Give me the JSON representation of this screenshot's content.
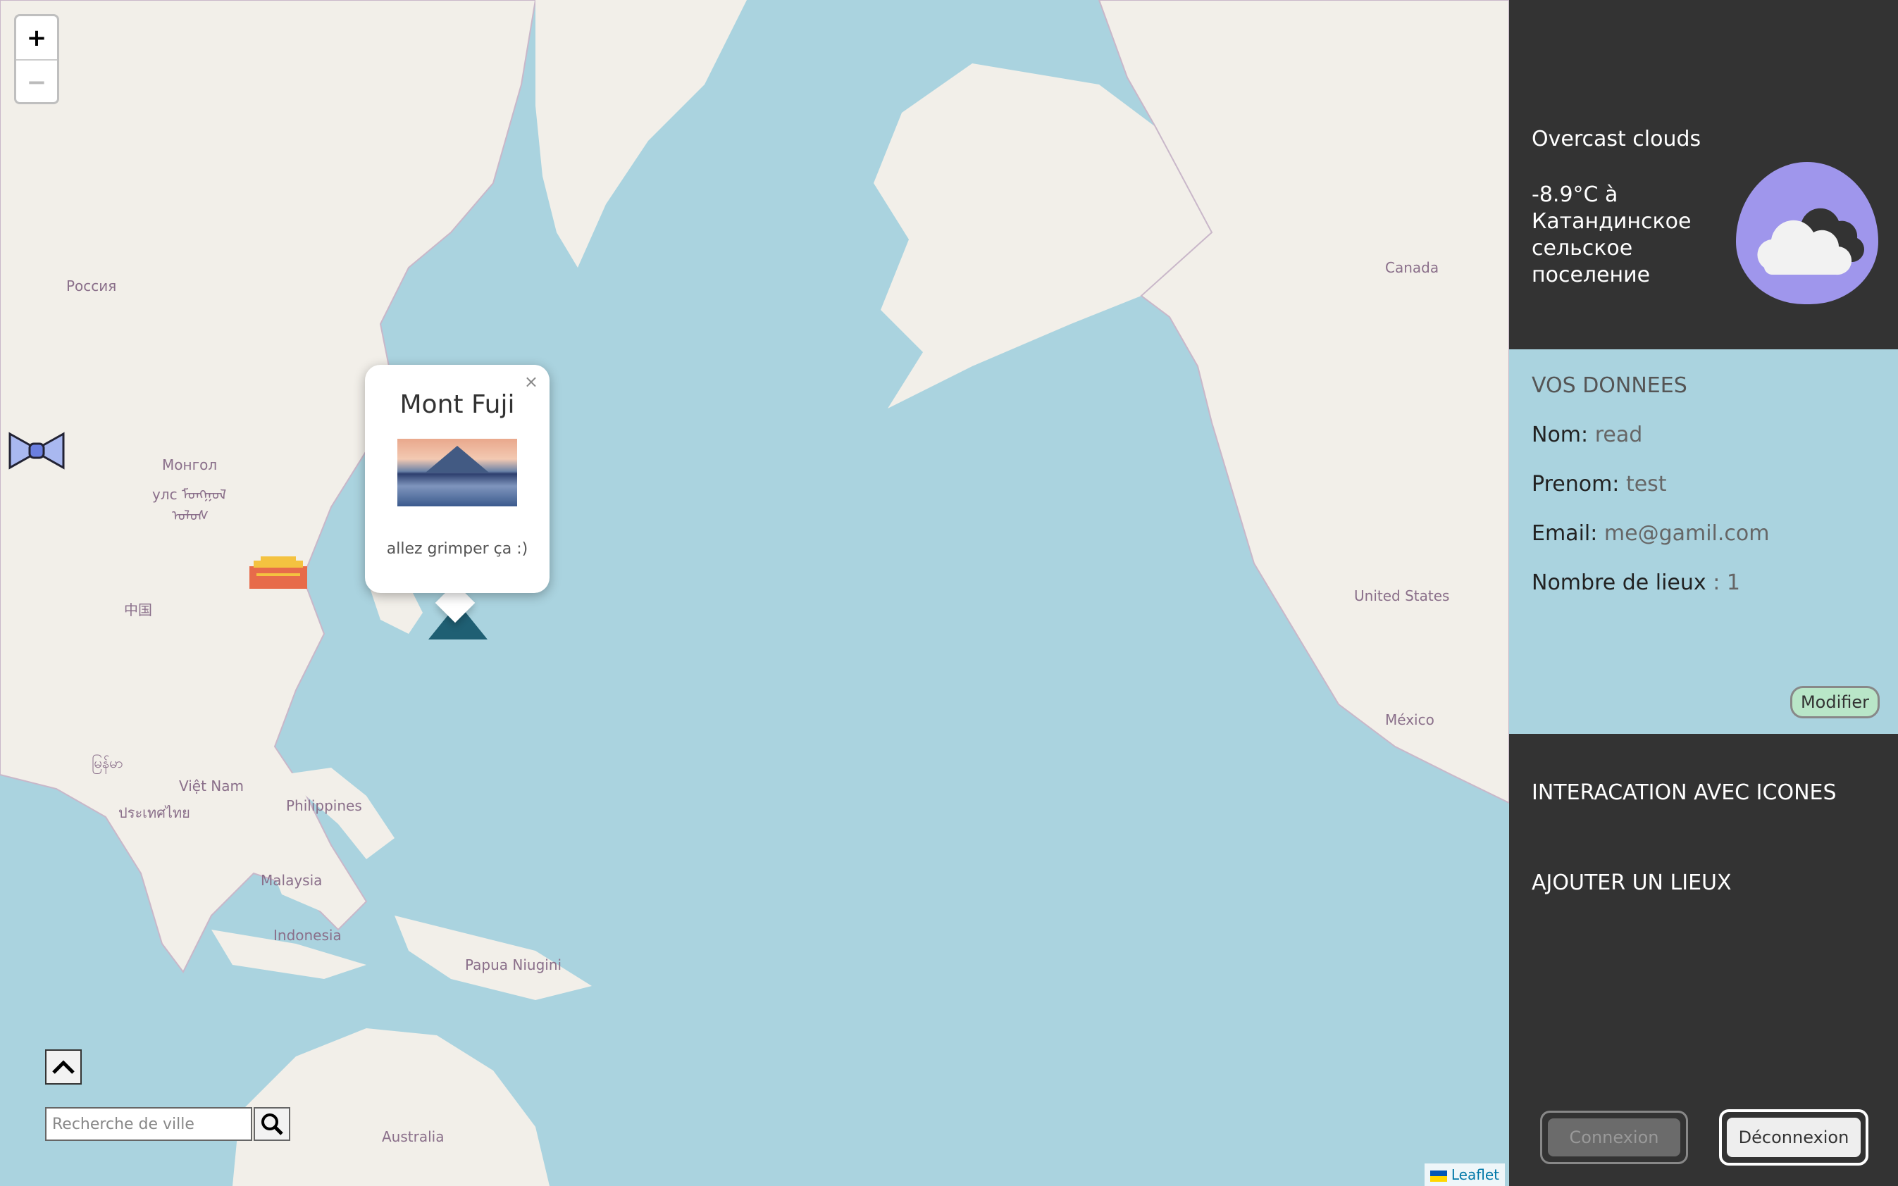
{
  "map": {
    "zoom_in": "+",
    "zoom_out": "−",
    "labels": {
      "russia": "Россия",
      "mongolia_1": "Монгол",
      "mongolia_2": "улс ᠮᠤᠩᠭᠤᠯ",
      "mongolia_3": "ᠤᠯᠤᠰ",
      "china": "中国",
      "myanmar": "မြန်မာ",
      "vietnam": "Việt Nam",
      "thailand": "ประเทศไทย",
      "philippines": "Philippines",
      "malaysia": "Malaysia",
      "indonesia": "Indonesia",
      "png": "Papua Niugini",
      "australia": "Australia",
      "canada": "Canada",
      "usa": "United States",
      "mexico": "México"
    },
    "popup": {
      "close": "×",
      "title": "Mont Fuji",
      "description": "allez grimper ça :)"
    },
    "search_placeholder": "Recherche de ville",
    "attribution": "Leaflet"
  },
  "weather": {
    "description": "Overcast clouds",
    "temperature": "-8.9°C à Катандинское сельское поселение",
    "icon": "cloud-icon"
  },
  "user_data": {
    "header": "VOS DONNEES",
    "nom_label": "Nom:",
    "nom_value": "read",
    "prenom_label": "Prenom:",
    "prenom_value": "test",
    "email_label": "Email:",
    "email_value": "me@gamil.com",
    "lieux_label": "Nombre de lieux",
    "lieux_value": ": 1",
    "modify_label": "Modifier"
  },
  "actions": {
    "icons_interaction": "INTERACATION AVEC ICONES",
    "add_place": "AJOUTER UN LIEUX",
    "login": "Connexion",
    "logout": "Déconnexion"
  }
}
